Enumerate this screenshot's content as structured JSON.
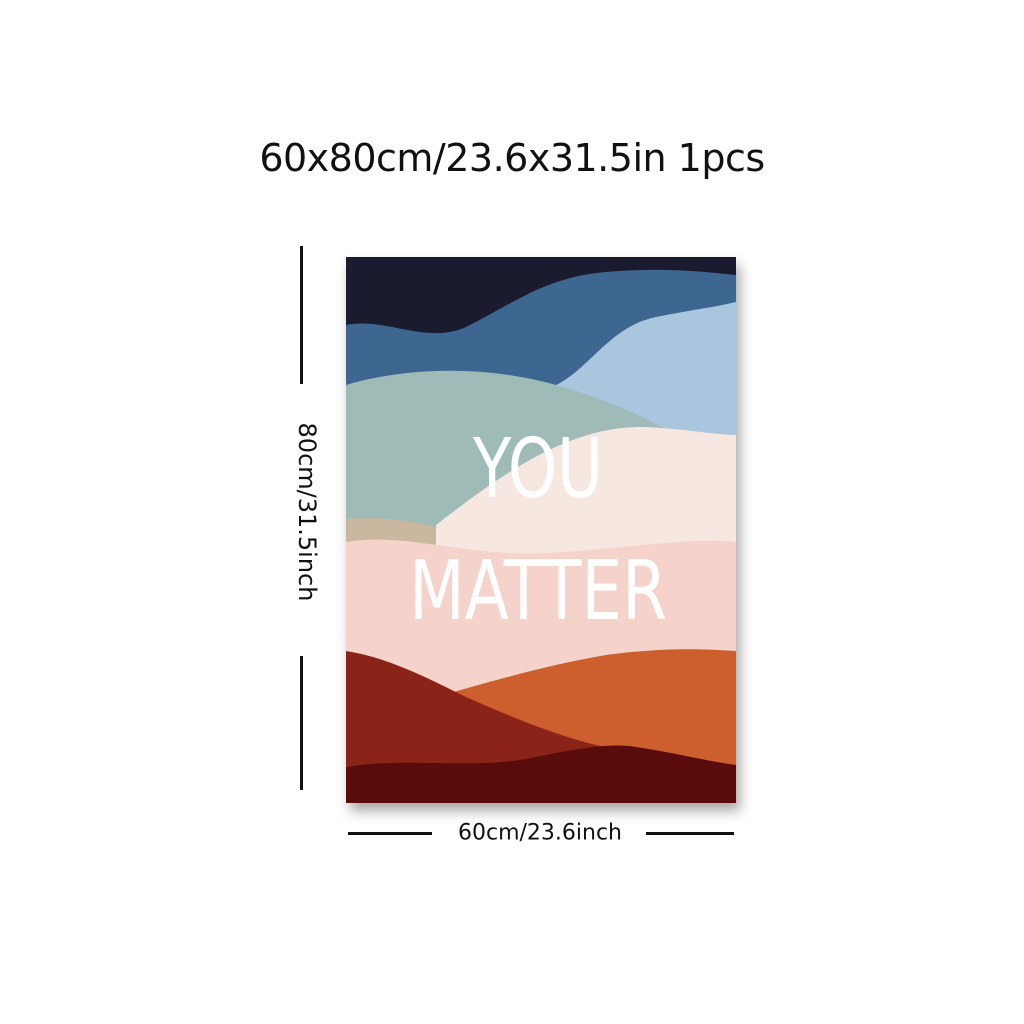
{
  "product": {
    "size_caption": "60x80cm/23.6x31.5in 1pcs",
    "height_dimension": "80cm/31.5inch",
    "width_dimension": "60cm/23.6inch"
  },
  "poster": {
    "text_line1": "YOU",
    "text_line2": "MATTER",
    "colors": {
      "night": "#1a1b2e",
      "deep_blue": "#3d6690",
      "light_blue": "#a9c6de",
      "sage": "#9fbbb7",
      "tan": "#c9b7a0",
      "cream": "#f6e7e1",
      "blush": "#f5d3cb",
      "burnt_orange": "#cd5f2e",
      "brick": "#8a2418",
      "maroon": "#5a0c0c"
    }
  }
}
